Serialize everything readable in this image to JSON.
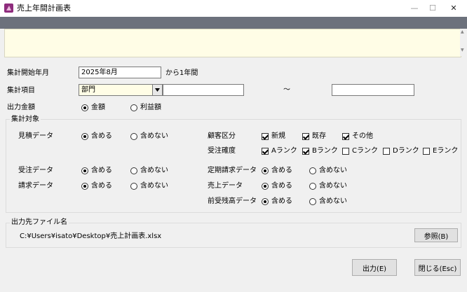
{
  "window": {
    "title": "売上年間計画表"
  },
  "form": {
    "start_month_label": "集計開始年月",
    "start_month_value": "2025年8月",
    "start_month_suffix": "から1年間",
    "item_label": "集計項目",
    "item_value": "部門",
    "range_sep": "〜",
    "amount_label": "出力金額",
    "amount_options": [
      {
        "label": "金額",
        "checked": true
      },
      {
        "label": "利益額",
        "checked": false
      }
    ]
  },
  "target_group": {
    "title": "集計対象",
    "rows": [
      {
        "label": "見積データ",
        "opt_in": "含める",
        "opt_out": "含めない",
        "selected": "in"
      },
      {
        "label": "受注データ",
        "opt_in": "含める",
        "opt_out": "含めない",
        "selected": "in"
      },
      {
        "label": "請求データ",
        "opt_in": "含める",
        "opt_out": "含めない",
        "selected": "in"
      }
    ],
    "customer_label": "顧客区分",
    "customer_options": [
      {
        "label": "新規",
        "checked": true
      },
      {
        "label": "既存",
        "checked": true
      },
      {
        "label": "その他",
        "checked": true
      }
    ],
    "certainty_label": "受注確度",
    "certainty_options": [
      {
        "label": "Aランク",
        "checked": true
      },
      {
        "label": "Bランク",
        "checked": true
      },
      {
        "label": "Cランク",
        "checked": false
      },
      {
        "label": "Dランク",
        "checked": false
      },
      {
        "label": "Eランク",
        "checked": false
      }
    ],
    "right_rows": [
      {
        "label": "定期請求データ",
        "opt_in": "含める",
        "opt_out": "含めない",
        "selected": "in"
      },
      {
        "label": "売上データ",
        "opt_in": "含める",
        "opt_out": "含めない",
        "selected": "in"
      },
      {
        "label": "前受残高データ",
        "opt_in": "含める",
        "opt_out": "含めない",
        "selected": "in"
      }
    ]
  },
  "output_group": {
    "title": "出力先ファイル名",
    "path": "C:¥Users¥isato¥Desktop¥売上計画表.xlsx",
    "browse_label": "参照(B)"
  },
  "footer": {
    "output_label": "出力(E)",
    "close_label": "閉じる(Esc)"
  },
  "colors": {
    "ribbon": "#6c717c",
    "notice": "#fffde6",
    "combo_highlight": "#fffde6"
  }
}
